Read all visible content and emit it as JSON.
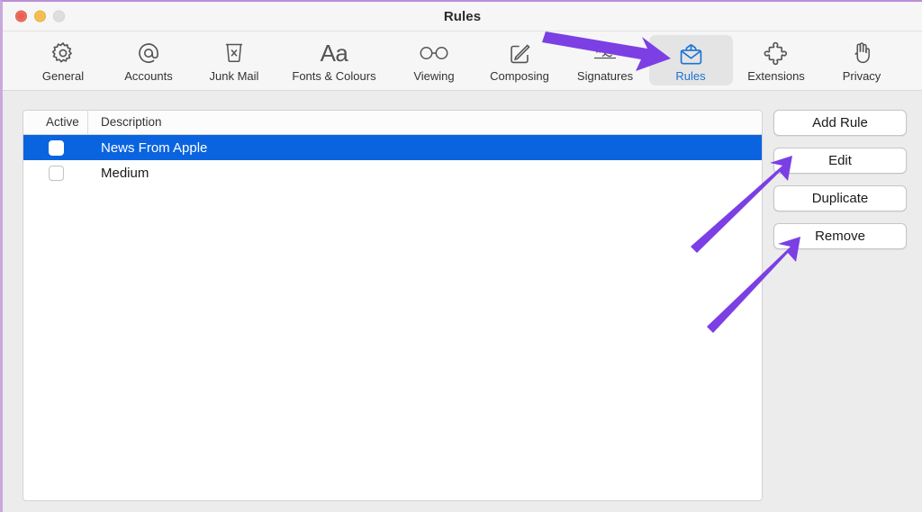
{
  "window": {
    "title": "Rules",
    "traffic_lights": [
      "close-button",
      "minimize-button",
      "zoom-button"
    ]
  },
  "toolbar": {
    "items": [
      {
        "label": "General",
        "icon": "gear-icon",
        "selected": false
      },
      {
        "label": "Accounts",
        "icon": "at-sign-icon",
        "selected": false
      },
      {
        "label": "Junk Mail",
        "icon": "trash-x-icon",
        "selected": false
      },
      {
        "label": "Fonts & Colours",
        "icon": "aa-text-icon",
        "selected": false
      },
      {
        "label": "Viewing",
        "icon": "glasses-icon",
        "selected": false
      },
      {
        "label": "Composing",
        "icon": "compose-pencil-icon",
        "selected": false
      },
      {
        "label": "Signatures",
        "icon": "signature-icon",
        "selected": false
      },
      {
        "label": "Rules",
        "icon": "rules-envelope-icon",
        "selected": true
      },
      {
        "label": "Extensions",
        "icon": "puzzle-piece-icon",
        "selected": false
      },
      {
        "label": "Privacy",
        "icon": "hand-icon",
        "selected": false
      }
    ]
  },
  "rules_table": {
    "columns": [
      "Active",
      "Description"
    ],
    "rows": [
      {
        "description": "News From Apple",
        "active": false,
        "selected": true
      },
      {
        "description": "Medium",
        "active": false,
        "selected": false
      }
    ]
  },
  "side_buttons": [
    {
      "label": "Add Rule"
    },
    {
      "label": "Edit"
    },
    {
      "label": "Duplicate"
    },
    {
      "label": "Remove"
    }
  ],
  "annotations": {
    "arrow_color": "#7b3fe4",
    "arrows": [
      {
        "name": "arrow-to-rules-tab",
        "points_to": "Rules"
      },
      {
        "name": "arrow-to-edit-button",
        "points_to": "Edit"
      },
      {
        "name": "arrow-to-remove-button",
        "points_to": "Remove"
      }
    ]
  },
  "colors": {
    "selection_blue": "#0a64e0",
    "accent_blue": "#1c72d4",
    "toolbar_bg": "#f6f6f6",
    "content_bg": "#ececec"
  }
}
